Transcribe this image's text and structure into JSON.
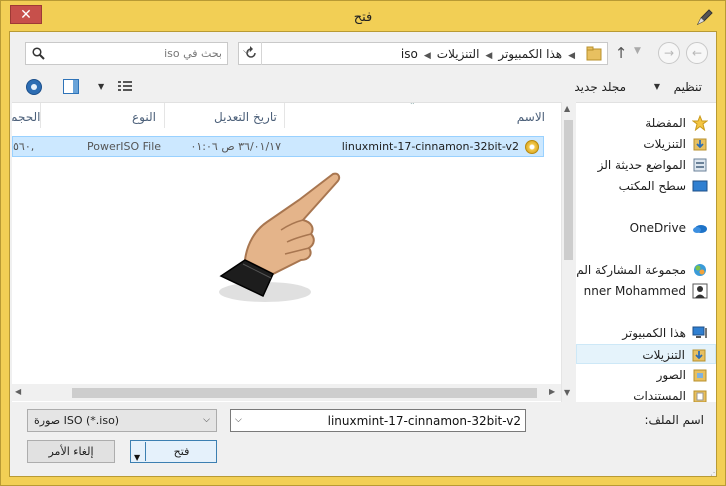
{
  "window": {
    "title": "فتح",
    "close_label": "✕"
  },
  "address": {
    "path": [
      "هذا الكمبيوتر",
      "التنزيلات",
      "iso"
    ]
  },
  "search": {
    "placeholder": "بحث في iso"
  },
  "toolbar": {
    "organize_label": "تنظيم",
    "new_folder_label": "مجلد جديد"
  },
  "nav_pane": {
    "items": [
      {
        "label": "المفضلة",
        "icon": "star-icon"
      },
      {
        "label": "التنزيلات",
        "icon": "downloads-folder-icon"
      },
      {
        "label": "المواضع حديثة الز",
        "icon": "recent-places-icon"
      },
      {
        "label": "سطح المكتب",
        "icon": "desktop-icon"
      },
      {
        "label": "OneDrive",
        "icon": "onedrive-icon"
      },
      {
        "label": "مجموعة المشاركة الم",
        "icon": "homegroup-icon"
      },
      {
        "label": "nner Mohammed",
        "icon": "user-icon"
      },
      {
        "label": "هذا الكمبيوتر",
        "icon": "computer-icon"
      },
      {
        "label": "التنزيلات",
        "icon": "downloads-folder-icon",
        "selected": true
      },
      {
        "label": "الصور",
        "icon": "pictures-folder-icon"
      },
      {
        "label": "المستندات",
        "icon": "documents-folder-icon"
      }
    ]
  },
  "file_list": {
    "columns": {
      "name": "الاسم",
      "date": "تاريخ التعديل",
      "type": "النوع",
      "size": "الحجم"
    },
    "rows": [
      {
        "name": "linuxmint-17-cinnamon-32bit-v2",
        "date": "٣٦/٠١/١٧ ص ٠١:٠٦",
        "type": "PowerISO File",
        "size": "٥٦٠,"
      }
    ]
  },
  "bottom": {
    "file_name_label": "اسم الملف:",
    "file_name_value": "linuxmint-17-cinnamon-32bit-v2",
    "filter_value": "صورة ISO (*.iso)",
    "open_label": "فتح",
    "cancel_label": "إلغاء الأمر"
  },
  "colors": {
    "frame": "#f2cf55",
    "close": "#c7504b",
    "selection": "#cce8ff",
    "accent": "#3c7fb1"
  }
}
